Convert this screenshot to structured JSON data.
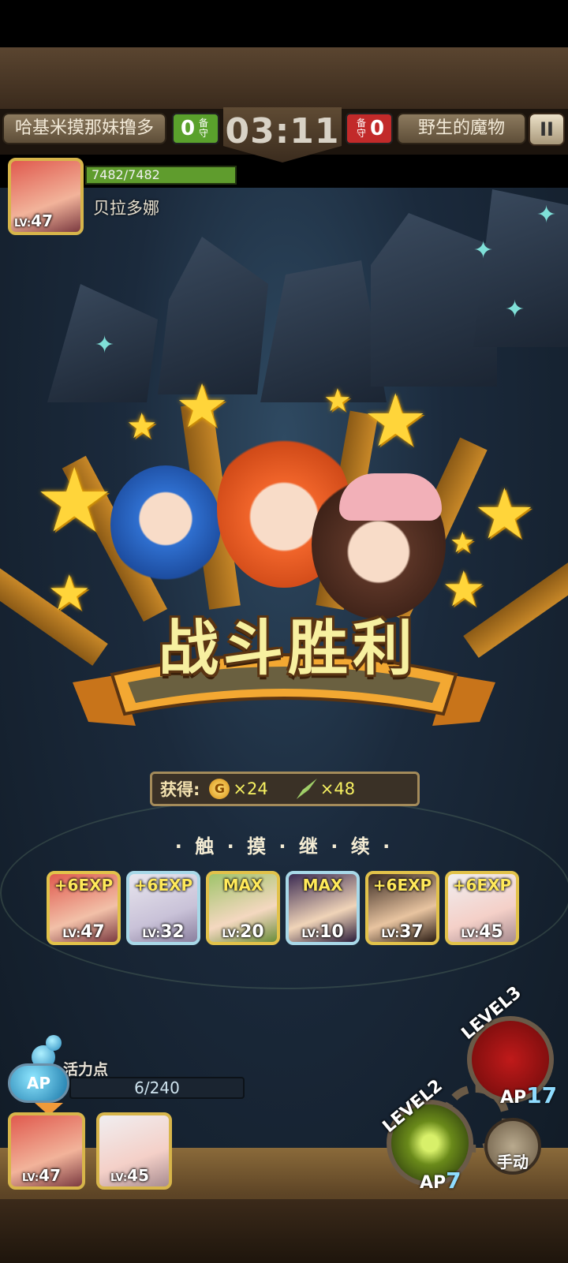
{
  "top_bar": {
    "player_name": "哈基米摸那妹撸多",
    "player_score": "0",
    "player_score_label": "备守",
    "timer": "03:11",
    "enemy_score": "0",
    "enemy_score_label": "备守",
    "enemy_name": "野生的魔物",
    "pause_label": "II"
  },
  "enemy": {
    "hp": "7482/7482",
    "hp_fraction": 1.0,
    "name": "贝拉多娜",
    "lv_prefix": "LV:",
    "level": "47"
  },
  "victory": {
    "title": "战斗胜利",
    "reward_label": "获得:",
    "coin_symbol": "G",
    "coin_qty": "×24",
    "item_qty": "×48",
    "touch_continue": "· 触 · 摸 · 继 · 续 ·"
  },
  "team": [
    {
      "exp": "+6EXP",
      "lv_prefix": "LV:",
      "level": "47"
    },
    {
      "exp": "+6EXP",
      "lv_prefix": "LV:",
      "level": "32"
    },
    {
      "exp": "MAX",
      "lv_prefix": "LV:",
      "level": "20"
    },
    {
      "exp": "MAX",
      "lv_prefix": "LV:",
      "level": "10"
    },
    {
      "exp": "+6EXP",
      "lv_prefix": "LV:",
      "level": "37"
    },
    {
      "exp": "+6EXP",
      "lv_prefix": "LV:",
      "level": "45"
    }
  ],
  "bottom": {
    "ap_label": "活力点",
    "ap_orb": "AP",
    "ap_value": "6/240",
    "bench": [
      {
        "lv_prefix": "LV:",
        "level": "47"
      },
      {
        "lv_prefix": "LV:",
        "level": "45"
      }
    ],
    "skill_level2": {
      "label": "LEVEL",
      "level": "2",
      "ap_label": "AP",
      "ap": "7"
    },
    "skill_level3": {
      "label": "LEVEL",
      "level": "3",
      "ap_label": "AP",
      "ap": "17"
    },
    "manual_label": "手动"
  }
}
